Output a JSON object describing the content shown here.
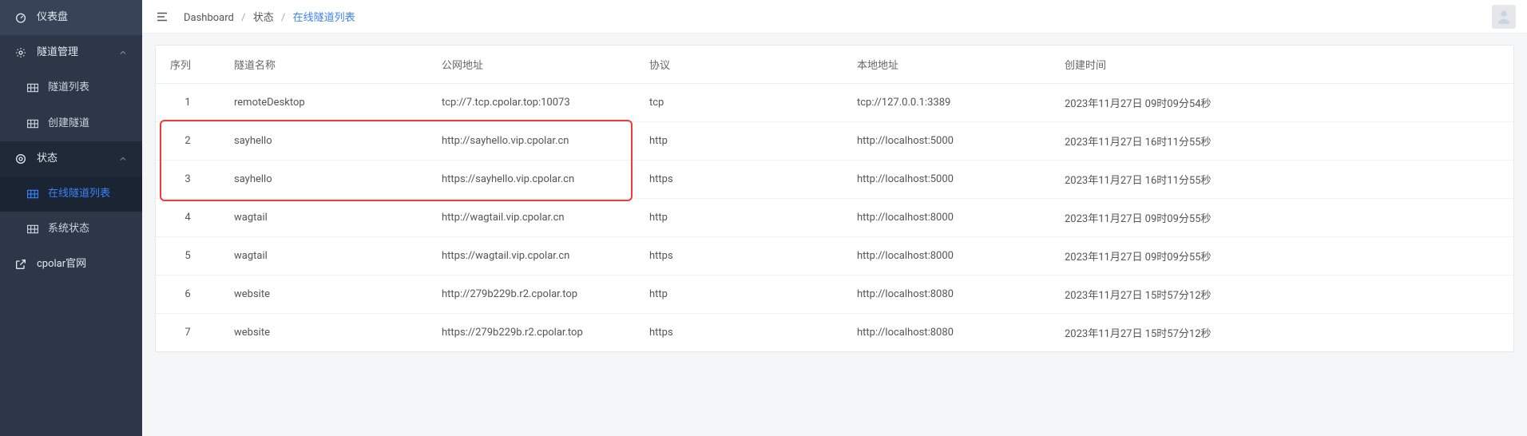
{
  "sidebar": {
    "dashboard": "仪表盘",
    "tunnelMgmt": "隧道管理",
    "tunnelList": "隧道列表",
    "tunnelCreate": "创建隧道",
    "status": "状态",
    "onlineTunnels": "在线隧道列表",
    "systemStatus": "系统状态",
    "cpolarSite": "cpolar官网"
  },
  "breadcrumb": {
    "dashboard": "Dashboard",
    "status": "状态",
    "current": "在线隧道列表"
  },
  "table": {
    "headers": {
      "seq": "序列",
      "name": "隧道名称",
      "url": "公网地址",
      "proto": "协议",
      "local": "本地地址",
      "time": "创建时间"
    },
    "rows": [
      {
        "seq": "1",
        "name": "remoteDesktop",
        "url": "tcp://7.tcp.cpolar.top:10073",
        "proto": "tcp",
        "local": "tcp://127.0.0.1:3389",
        "time": "2023年11月27日 09时09分54秒"
      },
      {
        "seq": "2",
        "name": "sayhello",
        "url": "http://sayhello.vip.cpolar.cn",
        "proto": "http",
        "local": "http://localhost:5000",
        "time": "2023年11月27日 16时11分55秒"
      },
      {
        "seq": "3",
        "name": "sayhello",
        "url": "https://sayhello.vip.cpolar.cn",
        "proto": "https",
        "local": "http://localhost:5000",
        "time": "2023年11月27日 16时11分55秒"
      },
      {
        "seq": "4",
        "name": "wagtail",
        "url": "http://wagtail.vip.cpolar.cn",
        "proto": "http",
        "local": "http://localhost:8000",
        "time": "2023年11月27日 09时09分55秒"
      },
      {
        "seq": "5",
        "name": "wagtail",
        "url": "https://wagtail.vip.cpolar.cn",
        "proto": "https",
        "local": "http://localhost:8000",
        "time": "2023年11月27日 09时09分55秒"
      },
      {
        "seq": "6",
        "name": "website",
        "url": "http://279b229b.r2.cpolar.top",
        "proto": "http",
        "local": "http://localhost:8080",
        "time": "2023年11月27日 15时57分12秒"
      },
      {
        "seq": "7",
        "name": "website",
        "url": "https://279b229b.r2.cpolar.top",
        "proto": "https",
        "local": "http://localhost:8080",
        "time": "2023年11月27日 15时57分12秒"
      }
    ]
  }
}
